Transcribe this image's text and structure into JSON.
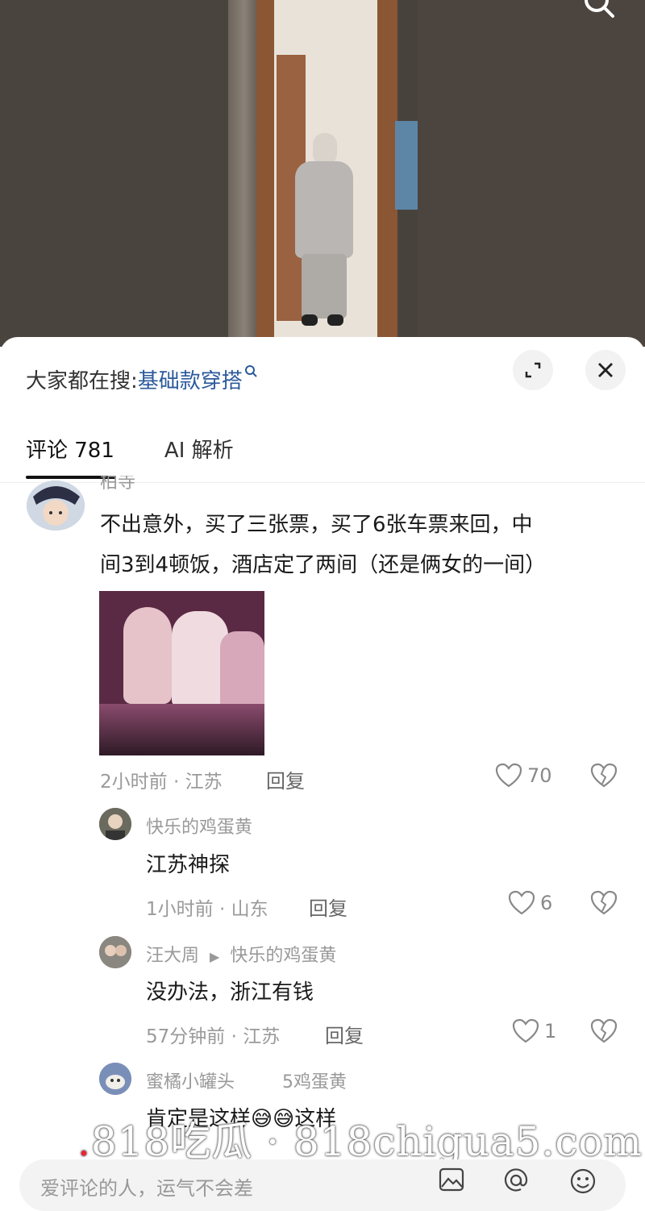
{
  "header": {
    "search_prefix": "大家都在搜:",
    "search_keyword": "基础款穿搭",
    "search_keyword_icon": "search-icon"
  },
  "tabs": [
    {
      "label": "评论 781",
      "active": true
    },
    {
      "label": "AI 解析",
      "active": false
    }
  ],
  "comment": {
    "author": "柏寺",
    "text_line1": "不出意外，买了三张票，买了6张车票来回，中",
    "text_line2": "间3到4顿饭，酒店定了两间（还是俩女的一间）",
    "time_location": "2小时前 · 江苏",
    "reply_label": "回复",
    "likes": "70"
  },
  "replies": [
    {
      "author": "快乐的鸡蛋黄",
      "reply_to": "",
      "text": "江苏神探",
      "time_location": "1小时前 · 山东",
      "reply_label": "回复",
      "likes": "6"
    },
    {
      "author": "汪大周",
      "reply_to": "快乐的鸡蛋黄",
      "text": "没办法，浙江有钱",
      "time_location": "57分钟前 · 江苏",
      "reply_label": "回复",
      "likes": "1"
    },
    {
      "author": "蜜橘小罐头",
      "reply_to": "鸡蛋黄",
      "text": "肯定是这样😅😅这样",
      "reply_to_prefix": "5"
    }
  ],
  "composer": {
    "placeholder": "爱评论的人，运气不会差"
  },
  "watermark": {
    "dot": ".",
    "text": "818吃瓜 · 818chigua5.com"
  },
  "colors": {
    "link": "#2b5a9c",
    "muted": "#9a9a9a"
  }
}
